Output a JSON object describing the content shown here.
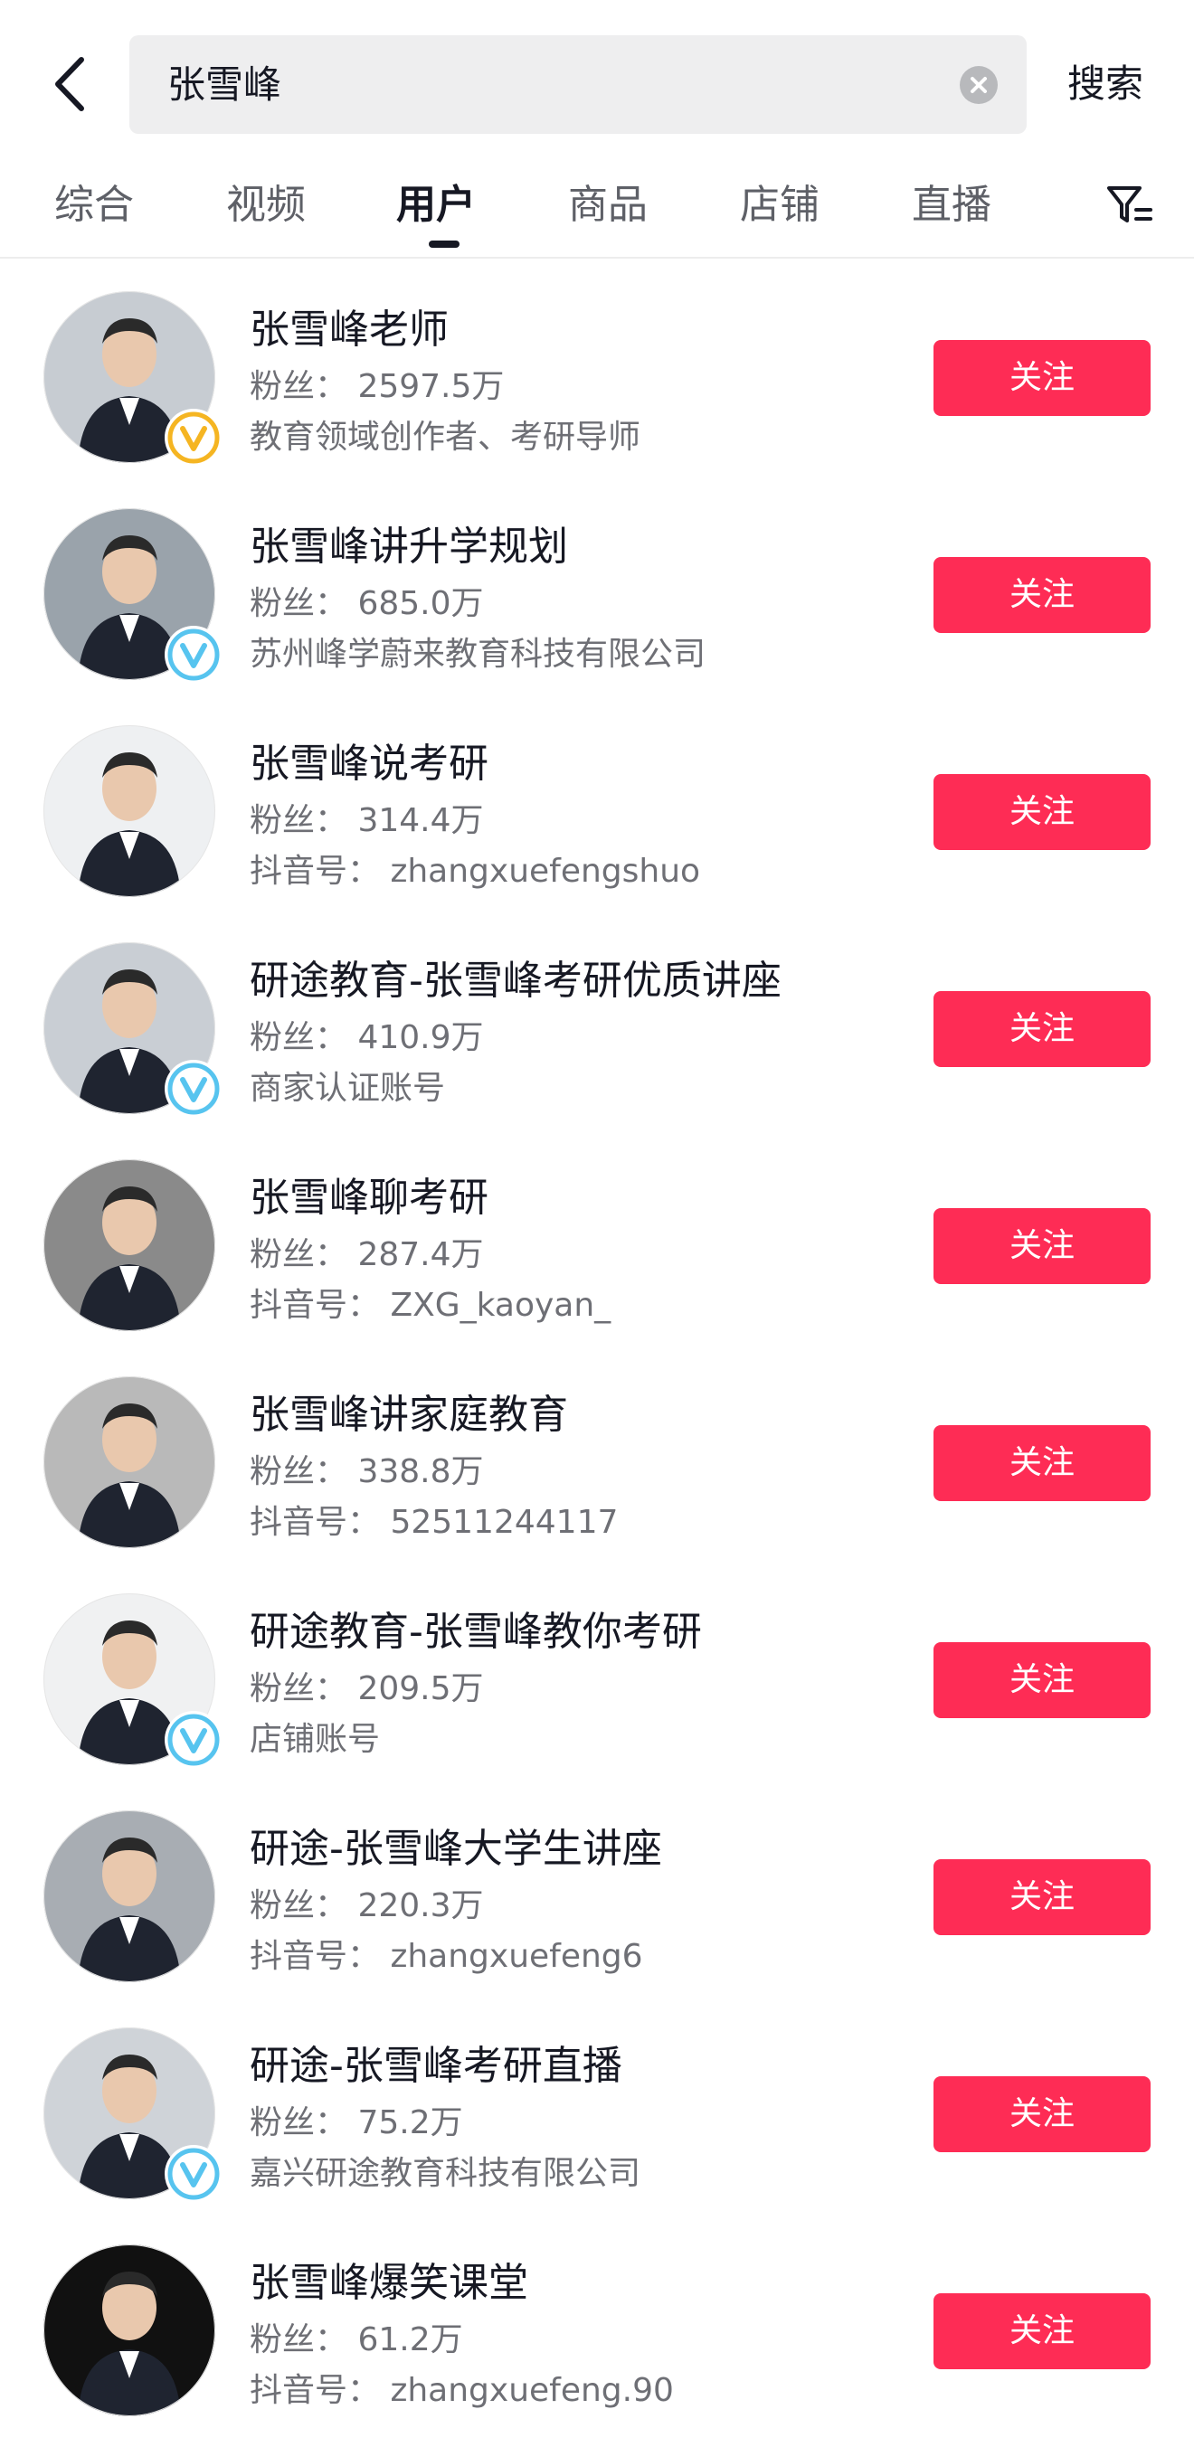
{
  "search": {
    "query": "张雪峰",
    "submit_label": "搜索"
  },
  "tabs": [
    {
      "label": "综合",
      "active": false
    },
    {
      "label": "视频",
      "active": false
    },
    {
      "label": "用户",
      "active": true
    },
    {
      "label": "商品",
      "active": false
    },
    {
      "label": "店铺",
      "active": false
    },
    {
      "label": "直播",
      "active": false
    }
  ],
  "colors": {
    "follow_button": "#fe2c55",
    "badge_gold": "#f5b522",
    "badge_blue": "#57c4ef"
  },
  "users": [
    {
      "name": "张雪峰老师",
      "fans_label": "粉丝：",
      "fans": "2597.5万",
      "desc": "教育领域创作者、考研导师",
      "badge": "gold-v-badge",
      "follow_label": "关注"
    },
    {
      "name": "张雪峰讲升学规划",
      "fans_label": "粉丝：",
      "fans": "685.0万",
      "desc": "苏州峰学蔚来教育科技有限公司",
      "badge": "blue-v-badge",
      "follow_label": "关注"
    },
    {
      "name": "张雪峰说考研",
      "fans_label": "粉丝：",
      "fans": "314.4万",
      "desc": "抖音号：  zhangxuefengshuo",
      "badge": "",
      "follow_label": "关注"
    },
    {
      "name": "研途教育-张雪峰考研优质讲座",
      "fans_label": "粉丝：",
      "fans": "410.9万",
      "desc": "商家认证账号",
      "badge": "blue-v-badge",
      "follow_label": "关注"
    },
    {
      "name": "张雪峰聊考研",
      "fans_label": "粉丝：",
      "fans": "287.4万",
      "desc": "抖音号：  ZXG_kaoyan_",
      "badge": "",
      "follow_label": "关注"
    },
    {
      "name": "张雪峰讲家庭教育",
      "fans_label": "粉丝：",
      "fans": "338.8万",
      "desc": "抖音号：  52511244117",
      "badge": "",
      "follow_label": "关注"
    },
    {
      "name": "研途教育-张雪峰教你考研",
      "fans_label": "粉丝：",
      "fans": "209.5万",
      "desc": "店铺账号",
      "badge": "blue-v-badge",
      "follow_label": "关注"
    },
    {
      "name": "研途-张雪峰大学生讲座",
      "fans_label": "粉丝：",
      "fans": "220.3万",
      "desc": "抖音号：  zhangxuefeng6",
      "badge": "",
      "follow_label": "关注"
    },
    {
      "name": "研途-张雪峰考研直播",
      "fans_label": "粉丝：",
      "fans": "75.2万",
      "desc": "嘉兴研途教育科技有限公司",
      "badge": "blue-v-badge",
      "follow_label": "关注"
    },
    {
      "name": "张雪峰爆笑课堂",
      "fans_label": "粉丝：",
      "fans": "61.2万",
      "desc": "抖音号：  zhangxuefeng.90",
      "badge": "",
      "follow_label": "关注"
    }
  ]
}
